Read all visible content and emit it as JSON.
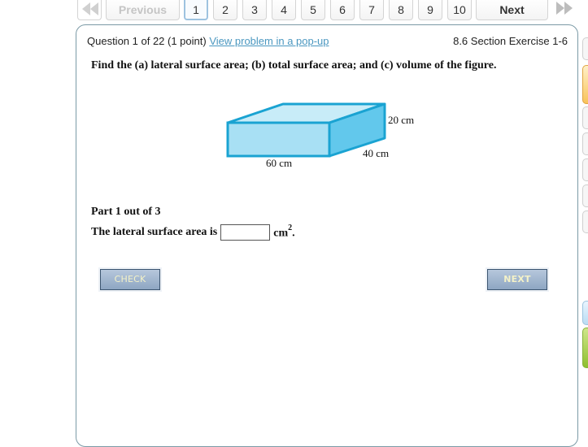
{
  "pager": {
    "first_icon": "double-left-arrow-icon",
    "previous_label": "Previous",
    "pages": [
      "1",
      "2",
      "3",
      "4",
      "5",
      "6",
      "7",
      "8",
      "9",
      "10"
    ],
    "current_page": "1",
    "next_label": "Next",
    "last_icon": "double-right-arrow-icon"
  },
  "question": {
    "header": "Question 1 of 22 (1 point)",
    "popup_link": "View problem in a pop-up",
    "section": "8.6 Section Exercise 1-6",
    "prompt": "Find the (a) lateral surface area; (b) total surface area; and (c) volume of the figure."
  },
  "figure": {
    "shape": "rectangular-prism",
    "length_label": "60 cm",
    "width_label": "40 cm",
    "height_label": "20 cm",
    "colors": {
      "front": "#a8e0f4",
      "top": "#c8ecf8",
      "side": "#62c8ec",
      "edge": "#1aa3d2"
    }
  },
  "part": {
    "label": "Part 1 out of 3",
    "statement": "The lateral surface area is",
    "answer_value": "",
    "unit": "cm",
    "unit_exponent": "2",
    "trailing": "."
  },
  "buttons": {
    "check": "CHECK",
    "next": "NEXT"
  },
  "side_tabs": [
    "tab-1",
    "tab-2-active",
    "tab-3",
    "tab-4",
    "tab-5",
    "tab-6",
    "tab-7",
    "tab-8-info",
    "tab-9-go"
  ]
}
